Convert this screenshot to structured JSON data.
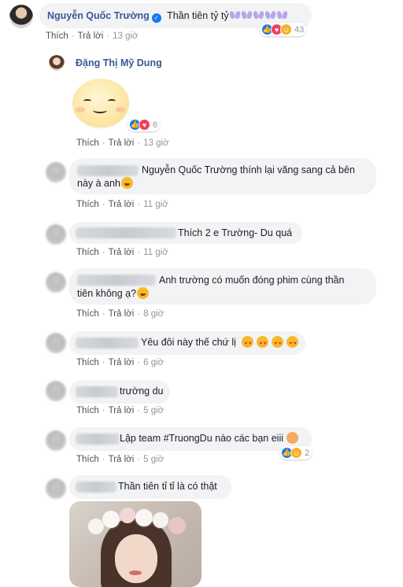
{
  "top_comment": {
    "author": "Nguyễn Quốc Trường",
    "text": "Thần tiên tỷ tỷ",
    "decor_icon": "butterfly",
    "reactions": [
      "like",
      "love",
      "haha"
    ],
    "reaction_count": "43",
    "like_label": "Thích",
    "reply_label": "Trả lời",
    "time": "13 giờ"
  },
  "reply_main": {
    "author": "Đặng Thị Mỹ Dung",
    "sticker": "smile-sticker",
    "reactions": [
      "like",
      "love"
    ],
    "reaction_count": "6",
    "like_label": "Thích",
    "reply_label": "Trả lời",
    "time": "13 giờ"
  },
  "replies": [
    {
      "text_line1": "Nguyễn Quốc Trường thính lại văng sang cả bên",
      "text_line2": "này à anh",
      "emoji": "laughing",
      "like_label": "Thích",
      "reply_label": "Trả lời",
      "time": "11 giờ"
    },
    {
      "text_line1": "Thích 2 e Trường- Du quá",
      "like_label": "Thích",
      "reply_label": "Trả lời",
      "time": "11 giờ"
    },
    {
      "text_line1": "Anh trường có muốn đóng phim cùng thần",
      "text_line2": "tiên không ạ?",
      "emoji": "grin",
      "like_label": "Thích",
      "reply_label": "Trả lời",
      "time": "8 giờ"
    },
    {
      "text_line1": "Yêu đôi này thế chứ lị",
      "emoji": "heart-eyes",
      "like_label": "Thích",
      "reply_label": "Trả lời",
      "time": "6 giờ"
    },
    {
      "text_line1": "trường du",
      "like_label": "Thích",
      "reply_label": "Trả lời",
      "time": "5 giờ"
    },
    {
      "text_line1": "Lập team #TruongDu nào các bạn eiii",
      "emoji": "couple",
      "reactions": [
        "like",
        "haha"
      ],
      "reaction_count": "2",
      "like_label": "Thích",
      "reply_label": "Trả lời",
      "time": "5 giờ"
    },
    {
      "text_line1": "Thần tiên tỉ tỉ là có thật",
      "photo": "flower-crown-girl"
    }
  ],
  "colors": {
    "name": "#385898",
    "bubble": "#f2f3f5",
    "meta": "#90949c",
    "like": "#1877f2",
    "love": "#f33e58",
    "haha": "#f7b125"
  }
}
